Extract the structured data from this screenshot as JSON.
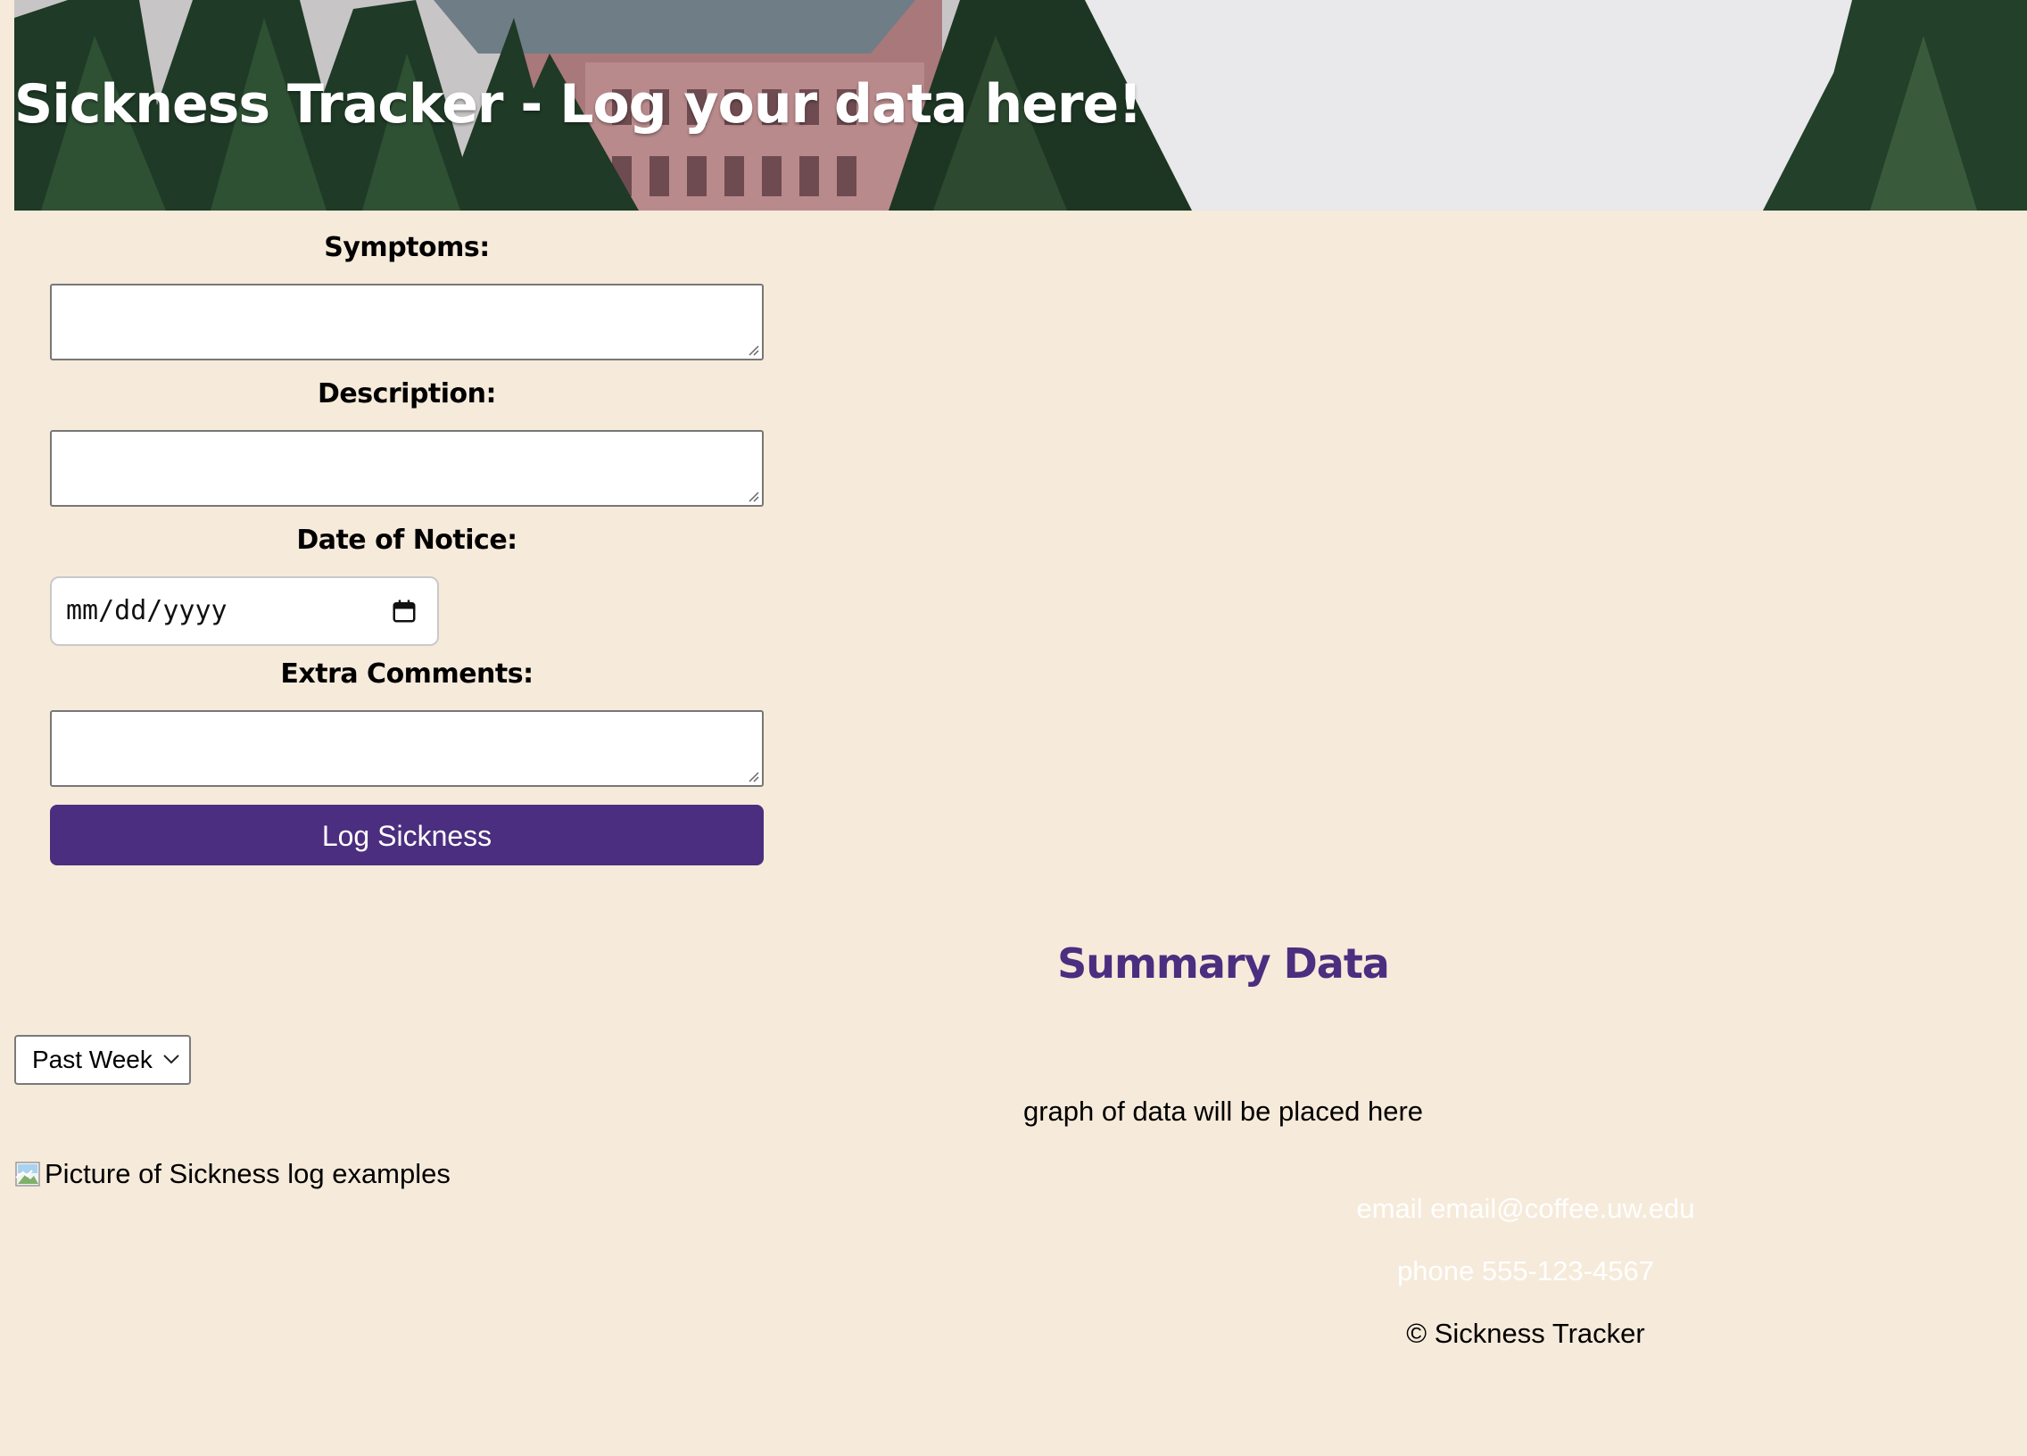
{
  "header": {
    "title": "Sickness Tracker - Log your data here!"
  },
  "form": {
    "symptoms_label": "Symptoms:",
    "symptoms_value": "",
    "description_label": "Description:",
    "description_value": "",
    "date_label": "Date of Notice:",
    "date_placeholder": "mm/dd/yyyy",
    "comments_label": "Extra Comments:",
    "comments_value": "",
    "submit_label": "Log Sickness"
  },
  "summary": {
    "title": "Summary Data",
    "range_select": "Past Week",
    "graph_placeholder": "graph of data will be placed here",
    "image_alt": "Picture of Sickness log examples"
  },
  "footer": {
    "email": "email email@coffee.uw.edu",
    "phone": "phone 555-123-4567",
    "copyright": "© Sickness Tracker"
  },
  "colors": {
    "background": "#f6eada",
    "accent_purple": "#4b2e7f",
    "header_text": "#ffffff"
  },
  "icons": {
    "date_picker": "calendar-icon",
    "select": "chevron-down-icon",
    "broken_image": "broken-image-icon"
  }
}
